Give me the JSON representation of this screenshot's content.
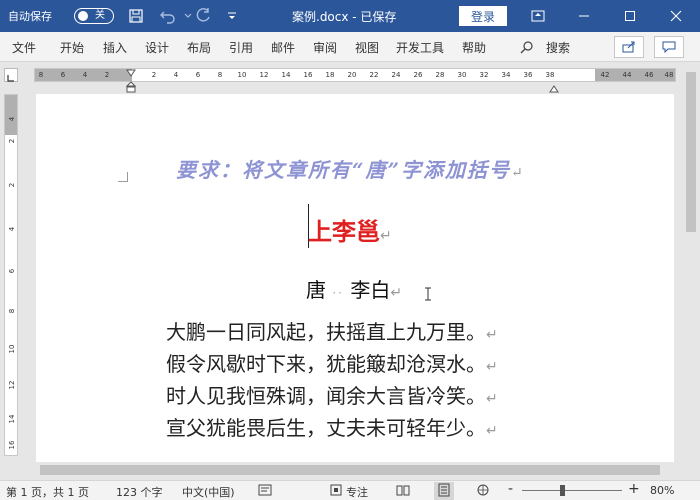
{
  "titlebar": {
    "autosave_label": "自动保存",
    "autosave_state": "关",
    "doc_title": "案例.docx - 已保存",
    "login_label": "登录"
  },
  "menu": {
    "items": [
      "文件",
      "开始",
      "插入",
      "设计",
      "布局",
      "引用",
      "邮件",
      "审阅",
      "视图",
      "开发工具",
      "帮助"
    ],
    "search_label": "搜索"
  },
  "ruler": {
    "left_nums": [
      "8",
      "6",
      "4",
      "2"
    ],
    "main_nums": [
      "2",
      "4",
      "6",
      "8",
      "10",
      "12",
      "14",
      "16",
      "18",
      "20",
      "22",
      "24",
      "26",
      "28",
      "30",
      "32",
      "34",
      "36",
      "38"
    ],
    "right_nums": [
      "42",
      "44",
      "46",
      "48"
    ],
    "v_nums": [
      "4",
      "2",
      "2",
      "4",
      "6",
      "8",
      "10",
      "12",
      "14",
      "16"
    ]
  },
  "document": {
    "requirement": "要求：将文章所有“唐”字添加括号",
    "title": "上李邕",
    "author_dynasty": "唐",
    "author_sep": "··",
    "author_name": "李白",
    "poem_lines": [
      "大鹏一日同风起，扶摇直上九万里。",
      "假令风歇时下来，犹能簸却沧溟水。",
      "时人见我恒殊调，闻余大言皆冷笑。",
      "宣父犹能畏后生，丈夫未可轻年少。"
    ],
    "para_mark": "↵"
  },
  "status": {
    "page": "第 1 页，共 1 页",
    "words": "123 个字",
    "lang": "中文(中国)",
    "focus": "专注",
    "zoom": "80%",
    "zoom_minus": "-",
    "zoom_plus": "+"
  },
  "colors": {
    "titlebar": "#2b579a",
    "requirement": "#8e93d4",
    "title": "#e02020"
  }
}
